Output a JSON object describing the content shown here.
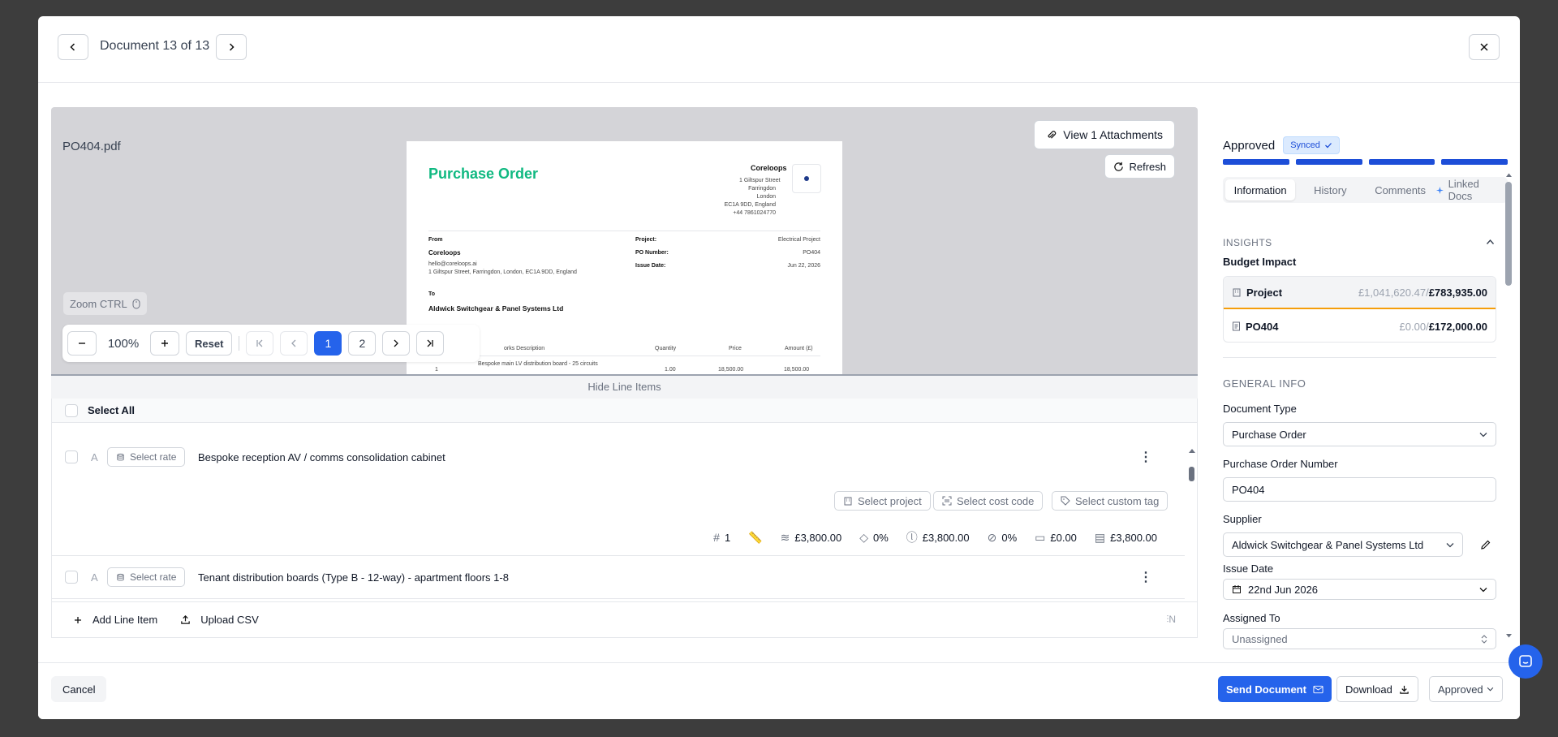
{
  "header": {
    "doc_position": "Document 13 of 13"
  },
  "preview": {
    "filename": "PO404.pdf",
    "attachments_label": "View 1 Attachments",
    "refresh_label": "Refresh",
    "zoom_hint": "Zoom CTRL",
    "zoom_value": "100%",
    "reset_label": "Reset",
    "pages": [
      "1",
      "2"
    ],
    "current_page": "1"
  },
  "pdf": {
    "title": "Purchase Order",
    "company": "Coreloops",
    "company_address": [
      "1 Giltspur Street",
      "Farringdon",
      "London",
      "EC1A 9DD, England",
      "+44 7861024770"
    ],
    "from_label": "From",
    "from_name": "Coreloops",
    "from_email": "hello@coreloops.ai",
    "from_address": "1 Giltspur Street, Farringdon, London, EC1A 9DD, England",
    "project_label": "Project:",
    "project_value": "Electrical Project",
    "po_label": "PO Number:",
    "po_value": "PO404",
    "issue_label": "Issue Date:",
    "issue_value": "Jun 22, 2026",
    "to_label": "To",
    "to_name": "Aldwick Switchgear & Panel Systems Ltd",
    "col_desc": "orks Description",
    "col_qty": "Quantity",
    "col_price": "Price",
    "col_amount": "Amount (£)",
    "row1_no": "1",
    "row1_desc": "Bespoke main LV distribution board - 25 circuits",
    "row1_qty": "1.00",
    "row1_price": "18,500.00",
    "row1_amount": "18,500.00"
  },
  "line_items": {
    "hide_label": "Hide Line Items",
    "select_all": "Select All",
    "items": [
      {
        "letter": "A",
        "rate": "Select rate",
        "description": "Bespoke reception AV / comms consolidation cabinet",
        "select_project": "Select project",
        "select_cost_code": "Select cost code",
        "select_custom_tag": "Select custom tag",
        "qty": "1",
        "net": "£3,800.00",
        "discount": "0%",
        "subtotal": "£3,800.00",
        "tax_rate": "0%",
        "tax": "£0.00",
        "total": "£3,800.00"
      },
      {
        "letter": "A",
        "rate": "Select rate",
        "description": "Tenant distribution boards (Type B - 12-way) - apartment floors 1-8"
      }
    ],
    "add_line": "Add Line Item",
    "upload_csv": "Upload CSV",
    "shortcut": "N"
  },
  "footer": {
    "cancel": "Cancel",
    "send": "Send Document",
    "download": "Download",
    "status": "Approved"
  },
  "panel": {
    "status": "Approved",
    "synced": "Synced",
    "tabs": [
      "Information",
      "History",
      "Comments",
      "Linked Docs"
    ],
    "insights_title": "INSIGHTS",
    "budget_title": "Budget Impact",
    "budget": [
      {
        "name": "Project",
        "spent": "£1,041,620.47",
        "sep": "/",
        "total": "£783,935.00"
      },
      {
        "name": "PO404",
        "spent": "£0.00",
        "sep": "/",
        "total": "£172,000.00"
      }
    ],
    "general_title": "GENERAL INFO",
    "doc_type_label": "Document Type",
    "doc_type": "Purchase Order",
    "po_number_label": "Purchase Order Number",
    "po_number": "PO404",
    "supplier_label": "Supplier",
    "supplier": "Aldwick Switchgear & Panel Systems Ltd",
    "issue_date_label": "Issue Date",
    "issue_date": "22nd Jun 2026",
    "assigned_label": "Assigned To",
    "assigned": "Unassigned"
  },
  "colors": {
    "primary": "#2563eb",
    "pdf_title": "#10b981",
    "budget_warning": "#f59e0b"
  }
}
